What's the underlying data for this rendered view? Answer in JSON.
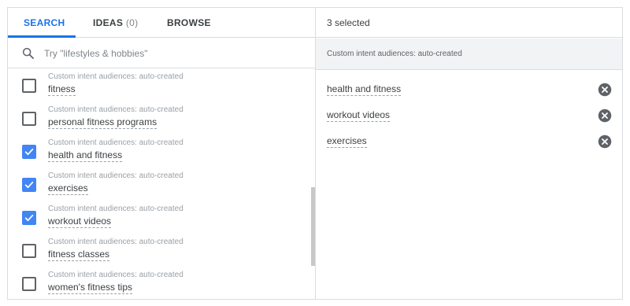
{
  "tabs": [
    {
      "label": "SEARCH"
    },
    {
      "label": "IDEAS",
      "count": "(0)"
    },
    {
      "label": "BROWSE"
    }
  ],
  "search": {
    "placeholder": "Try \"lifestyles & hobbies\""
  },
  "list": [
    {
      "category": "Custom intent audiences: auto-created",
      "name": "fitness",
      "checked": false
    },
    {
      "category": "Custom intent audiences: auto-created",
      "name": "personal fitness programs",
      "checked": false
    },
    {
      "category": "Custom intent audiences: auto-created",
      "name": "health and fitness",
      "checked": true
    },
    {
      "category": "Custom intent audiences: auto-created",
      "name": "exercises",
      "checked": true
    },
    {
      "category": "Custom intent audiences: auto-created",
      "name": "workout videos",
      "checked": true
    },
    {
      "category": "Custom intent audiences: auto-created",
      "name": "fitness classes",
      "checked": false
    },
    {
      "category": "Custom intent audiences: auto-created",
      "name": "women's fitness tips",
      "checked": false
    }
  ],
  "selected": {
    "count_label": "3 selected",
    "group_title": "Custom intent audiences: auto-created",
    "items": [
      {
        "name": "health and fitness"
      },
      {
        "name": "workout videos"
      },
      {
        "name": "exercises"
      }
    ]
  },
  "colors": {
    "accent": "#1a73e8",
    "checkbox_checked": "#4285f4",
    "remove_icon": "#5f6368"
  },
  "icons": {
    "search": "search-icon",
    "remove": "close-circle-icon",
    "check": "check-icon"
  }
}
